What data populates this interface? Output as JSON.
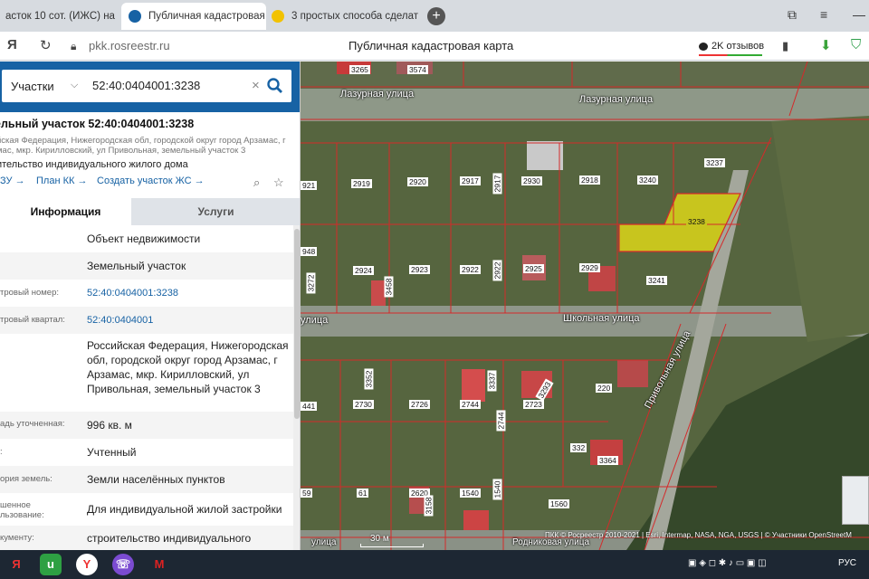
{
  "browser": {
    "tabs": [
      {
        "title": "асток 10 сот. (ИЖС) на",
        "active": false
      },
      {
        "title": "Публичная кадастровая",
        "active": true
      },
      {
        "title": "3 простых способа сделат",
        "active": false
      }
    ],
    "new_tab": "+",
    "url": "pkk.rosreestr.ru",
    "page_title": "Публичная кадастровая карта",
    "reviews": "2K отзывов"
  },
  "panel": {
    "search_type": "Участки",
    "search_value": "52:40:0404001:3238",
    "object_title": "ельный участок 52:40:0404001:3238",
    "object_address": "йская Федерация, Нижегородская обл, городской округ город Арзамас, г мас, мкр. Кирилловский, ул Привольная, земельный участок 3",
    "object_use": "ительство индивидуального жилого дома",
    "links": [
      "ЗУ →",
      "План КК →",
      "Создать участок ЖС →"
    ],
    "tabs": {
      "info": "Информация",
      "services": "Услуги"
    },
    "rows": [
      {
        "key": "",
        "value": "Объект недвижимости"
      },
      {
        "key": "",
        "value": "Земельный участок"
      },
      {
        "key": "тровый номер:",
        "value": "52:40:0404001:3238"
      },
      {
        "key": "тровый квартал:",
        "value": "52:40:0404001"
      },
      {
        "key": "",
        "value": "Российская Федерация, Нижегородская обл, городской округ город Арзамас, г Арзамас, мкр. Кирилловский, ул Привольная, земельный участок 3"
      },
      {
        "key": "адь уточненная:",
        "value": "996 кв. м"
      },
      {
        "key": ":",
        "value": "Учтенный"
      },
      {
        "key": "ория земель:",
        "value": "Земли населённых пунктов"
      },
      {
        "key": "шенное\nльзование:",
        "value": "Для индивидуальной жилой застройки"
      },
      {
        "key": "кументу:",
        "value": "строительство индивидуального"
      }
    ]
  },
  "map": {
    "streets": [
      "Лазурная улица",
      "Лазурная улица",
      "улица",
      "Школьная улица",
      "Привольная улица",
      "улица",
      "Родниковая улица"
    ],
    "parcels": [
      "3265",
      "3574",
      "921",
      "2919",
      "2920",
      "2917",
      "2917",
      "2930",
      "2918",
      "3240",
      "3237",
      "3238",
      "948",
      "3272",
      "2924",
      "3458",
      "2923",
      "2922",
      "2922",
      "2925",
      "2929",
      "3241",
      "3352",
      "2730",
      "2726",
      "2744",
      "3337",
      "2723",
      "3293",
      "220",
      "2744",
      "441",
      "332",
      "3364",
      "59",
      "61",
      "2620",
      "3158",
      "1540",
      "1540",
      "1560"
    ],
    "scale": "30 м",
    "attribution": "ПКК © Росреестр 2010-2021 | Esri, Intermap, NASA, NGA, USGS | © Участники OpenStreetM"
  },
  "taskbar": {
    "lang": "РУС"
  },
  "colors": {
    "panel_header": "#1762a4",
    "link": "#1762a4",
    "selected_parcel": "#c8c51e",
    "parcel_border": "#d42a2a"
  }
}
